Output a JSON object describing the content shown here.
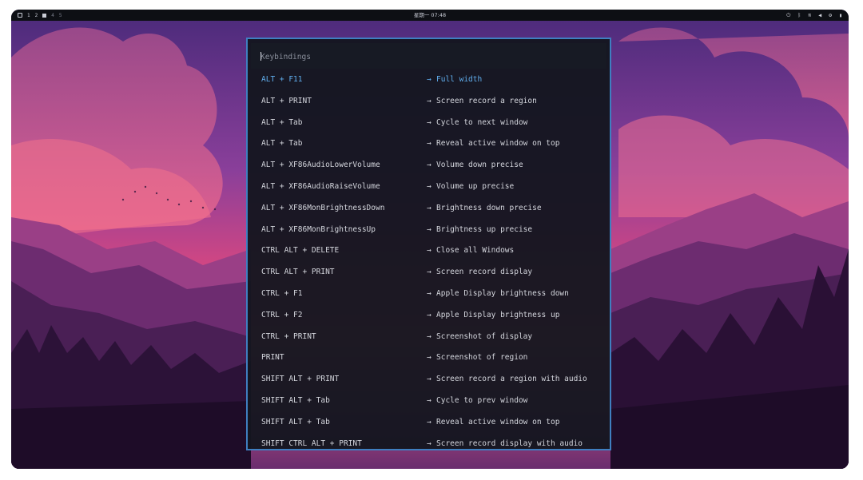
{
  "topbar": {
    "workspaces": [
      "1",
      "2",
      "4",
      "5"
    ],
    "clock": "星期一 07:48",
    "tray_icons": [
      "power-icon",
      "bluetooth-icon",
      "wifi-icon",
      "volume-icon",
      "settings-icon",
      "battery-icon"
    ]
  },
  "launcher": {
    "placeholder": "Keybindings",
    "arrow": "→",
    "items": [
      {
        "keys": "ALT + F11",
        "action": "Full width"
      },
      {
        "keys": "ALT + PRINT",
        "action": "Screen record a region"
      },
      {
        "keys": "ALT + Tab",
        "action": "Cycle to next window"
      },
      {
        "keys": "ALT + Tab",
        "action": "Reveal active window on top"
      },
      {
        "keys": "ALT + XF86AudioLowerVolume",
        "action": "Volume down precise"
      },
      {
        "keys": "ALT + XF86AudioRaiseVolume",
        "action": "Volume up precise"
      },
      {
        "keys": "ALT + XF86MonBrightnessDown",
        "action": "Brightness down precise"
      },
      {
        "keys": "ALT + XF86MonBrightnessUp",
        "action": "Brightness up precise"
      },
      {
        "keys": "CTRL ALT + DELETE",
        "action": "Close all Windows"
      },
      {
        "keys": "CTRL ALT + PRINT",
        "action": "Screen record display"
      },
      {
        "keys": "CTRL + F1",
        "action": "Apple Display brightness down"
      },
      {
        "keys": "CTRL + F2",
        "action": "Apple Display brightness up"
      },
      {
        "keys": "CTRL + PRINT",
        "action": "Screenshot of display"
      },
      {
        "keys": "PRINT",
        "action": "Screenshot of region"
      },
      {
        "keys": "SHIFT ALT + PRINT",
        "action": "Screen record a region with audio"
      },
      {
        "keys": "SHIFT ALT + Tab",
        "action": "Cycle to prev window"
      },
      {
        "keys": "SHIFT ALT + Tab",
        "action": "Reveal active window on top"
      },
      {
        "keys": "SHIFT CTRL ALT + PRINT",
        "action": "Screen record display with audio"
      }
    ]
  },
  "colors": {
    "selected": "#61afef",
    "border": "#3f7fc0",
    "text": "#d4d6dd"
  }
}
